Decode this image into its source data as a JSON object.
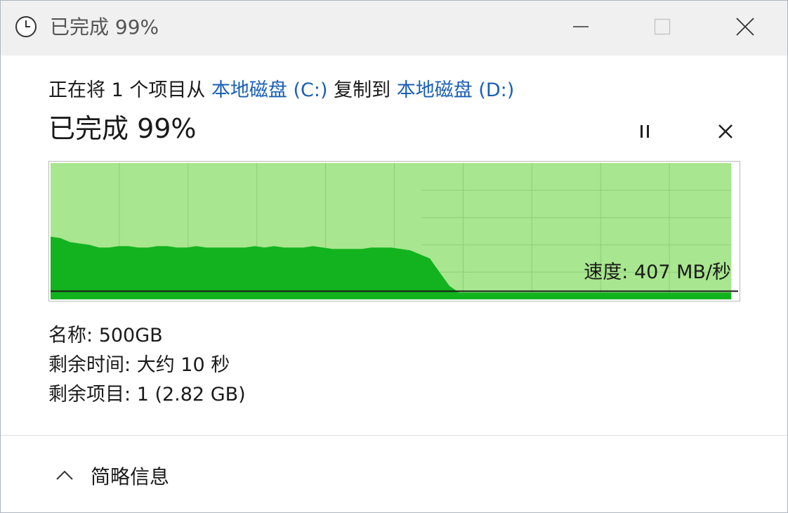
{
  "window": {
    "title": "已完成 99%",
    "icons": {
      "title": "clock-icon",
      "minimize": "minimize-icon",
      "maximize": "maximize-icon",
      "close": "close-icon"
    }
  },
  "summary": {
    "prefix": "正在将 1 个项目从 ",
    "source": "本地磁盘 (C:)",
    "middle": " 复制到 ",
    "destination": "本地磁盘 (D:)",
    "link_color": "#1a5fb4"
  },
  "progress": {
    "label": "已完成 99%",
    "percent": 99,
    "pause_icon": "pause-icon",
    "cancel_icon": "close-icon"
  },
  "graph": {
    "speed_label": "速度: 407 MB/秒",
    "progress_fill_color": "#a8e68f",
    "speed_fill_color": "#12b31f"
  },
  "chart_data": {
    "type": "area",
    "progress_fraction": 0.99,
    "speed_samples_fraction_of_max": [
      0.46,
      0.45,
      0.42,
      0.41,
      0.4,
      0.38,
      0.38,
      0.39,
      0.39,
      0.38,
      0.38,
      0.39,
      0.39,
      0.38,
      0.38,
      0.39,
      0.38,
      0.38,
      0.38,
      0.38,
      0.38,
      0.39,
      0.38,
      0.39,
      0.38,
      0.38,
      0.38,
      0.39,
      0.38,
      0.37,
      0.37,
      0.37,
      0.37,
      0.38,
      0.38,
      0.38,
      0.37,
      0.36,
      0.33,
      0.3,
      0.2,
      0.1,
      0.05,
      0.05,
      0.05,
      0.05,
      0.05,
      0.05,
      0.05,
      0.05,
      0.05,
      0.05,
      0.05,
      0.05,
      0.05,
      0.05,
      0.05,
      0.05,
      0.05,
      0.05,
      0.05,
      0.05,
      0.05,
      0.05,
      0.05,
      0.05,
      0.05,
      0.05,
      0.05,
      0.05,
      0.05
    ],
    "current_speed_fraction_of_max": 0.06,
    "grid": true
  },
  "details": {
    "name_label": "名称:",
    "name_value": "500GB",
    "time_label": "剩余时间:",
    "time_value": "大约 10 秒",
    "items_label": "剩余项目:",
    "items_value": "1 (2.82 GB)"
  },
  "footer": {
    "toggle_label": "简略信息",
    "toggle_icon": "chevron-up-icon"
  }
}
